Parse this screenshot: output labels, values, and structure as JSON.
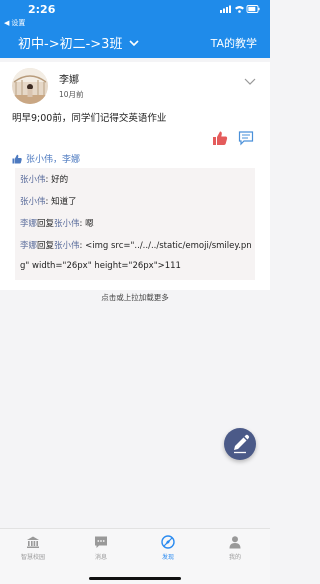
{
  "status_bar": {
    "time": "2:26",
    "back_label": "设置"
  },
  "nav": {
    "title": "初中->初二->3班",
    "right_link": "TA的教学"
  },
  "post": {
    "author": "李娜",
    "time": "10月前",
    "content": "明早9;00前，同学们记得交英语作业",
    "likes": "张小伟，李娜"
  },
  "comments": [
    {
      "from": "张小伟",
      "reply_word": "",
      "to": "",
      "text": ": 好的"
    },
    {
      "from": "张小伟",
      "reply_word": "",
      "to": "",
      "text": ": 知道了"
    },
    {
      "from": "李娜",
      "reply_word": "回复",
      "to": "张小伟",
      "text": ": 嗯"
    },
    {
      "from": "李娜",
      "reply_word": "回复",
      "to": "张小伟",
      "text": ": <img src=\"../../../static/emoji/smiley.png\" width=\"26px\" height=\"26px\">111"
    }
  ],
  "load_more": "点击或上拉加载更多",
  "tabs": [
    {
      "label": "智慧校园",
      "icon": "bank-icon"
    },
    {
      "label": "消息",
      "icon": "message-icon"
    },
    {
      "label": "发现",
      "icon": "discover-icon"
    },
    {
      "label": "我的",
      "icon": "profile-icon"
    }
  ],
  "colors": {
    "primary": "#1f8bea",
    "fab": "#4b5a88",
    "link": "#5b6d9c",
    "active_tab": "#2b8bf0"
  }
}
